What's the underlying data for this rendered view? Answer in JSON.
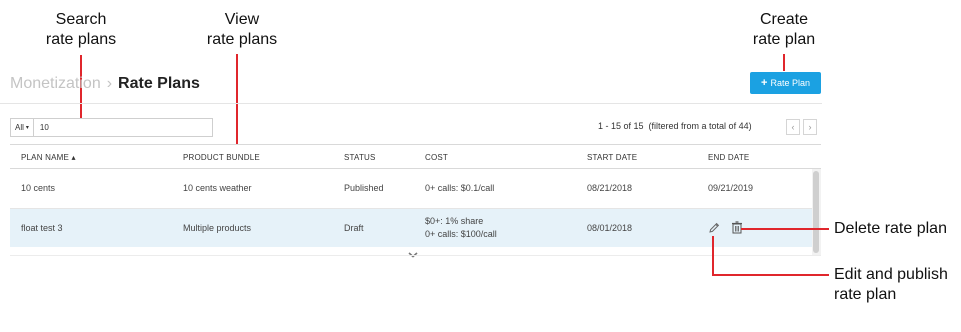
{
  "callouts": {
    "search": [
      "Search",
      "rate plans"
    ],
    "view": [
      "View",
      "rate plans"
    ],
    "create": [
      "Create",
      "rate plan"
    ],
    "delete": "Delete rate plan",
    "edit": [
      "Edit and publish",
      "rate plan"
    ]
  },
  "breadcrumb": {
    "parent": "Monetization",
    "separator": "›",
    "current": "Rate Plans"
  },
  "add_button": {
    "plus": "+",
    "label": "Rate Plan"
  },
  "search": {
    "filter": "All",
    "value": "10"
  },
  "pager": {
    "summary": "1 - 15 of 15  (filtered from a total of 44)",
    "prev": "‹",
    "next": "›"
  },
  "table": {
    "headers": [
      "PLAN NAME ▴",
      "PRODUCT BUNDLE",
      "STATUS",
      "COST",
      "START DATE",
      "END DATE"
    ],
    "rows": [
      {
        "plan_name": "10 cents",
        "product_bundle": "10 cents weather",
        "status": "Published",
        "cost": [
          "0+ calls: $0.1/call"
        ],
        "start_date": "08/21/2018",
        "end_date": "09/21/2019"
      },
      {
        "plan_name": "float test 3",
        "product_bundle": "Multiple products",
        "status": "Draft",
        "cost": [
          "$0+: 1% share",
          "0+ calls: $100/call"
        ],
        "start_date": "08/01/2018",
        "end_date": ""
      }
    ]
  },
  "colors": {
    "accent": "#1ba1e2",
    "callout_line": "#e0262c",
    "selected_row": "#e6f2f9"
  },
  "icons": {
    "edit": "pencil-icon",
    "delete": "trash-icon",
    "more": "chevron-down-icon"
  }
}
